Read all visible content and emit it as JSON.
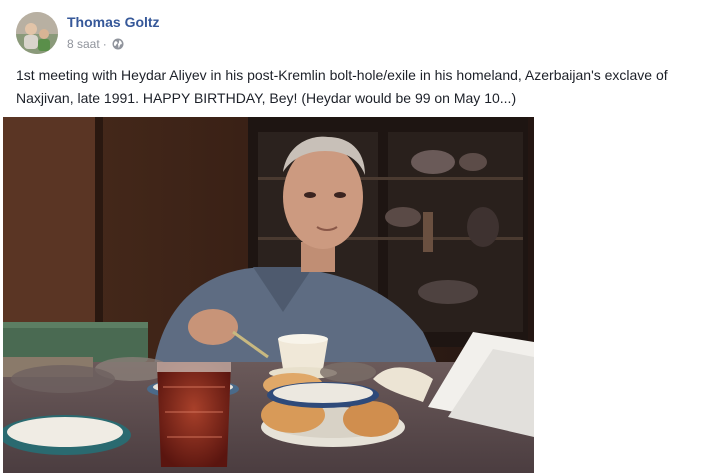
{
  "post": {
    "author": "Thomas Goltz",
    "time": "8 saat",
    "separator": "·",
    "audience_icon": "globe-icon",
    "text": "1st meeting with Heydar Aliyev in his post-Kremlin bolt-hole/exile in his homeland, Azerbaijan's exclave of Naxjivan, late 1991. HAPPY BIRTHDAY, Bey! (Heydar would be 99 on May 10...)",
    "photo_icon": "photo-image",
    "colors": {
      "author_link": "#365899",
      "meta_text": "#90949c",
      "body_text": "#1d2129"
    }
  }
}
